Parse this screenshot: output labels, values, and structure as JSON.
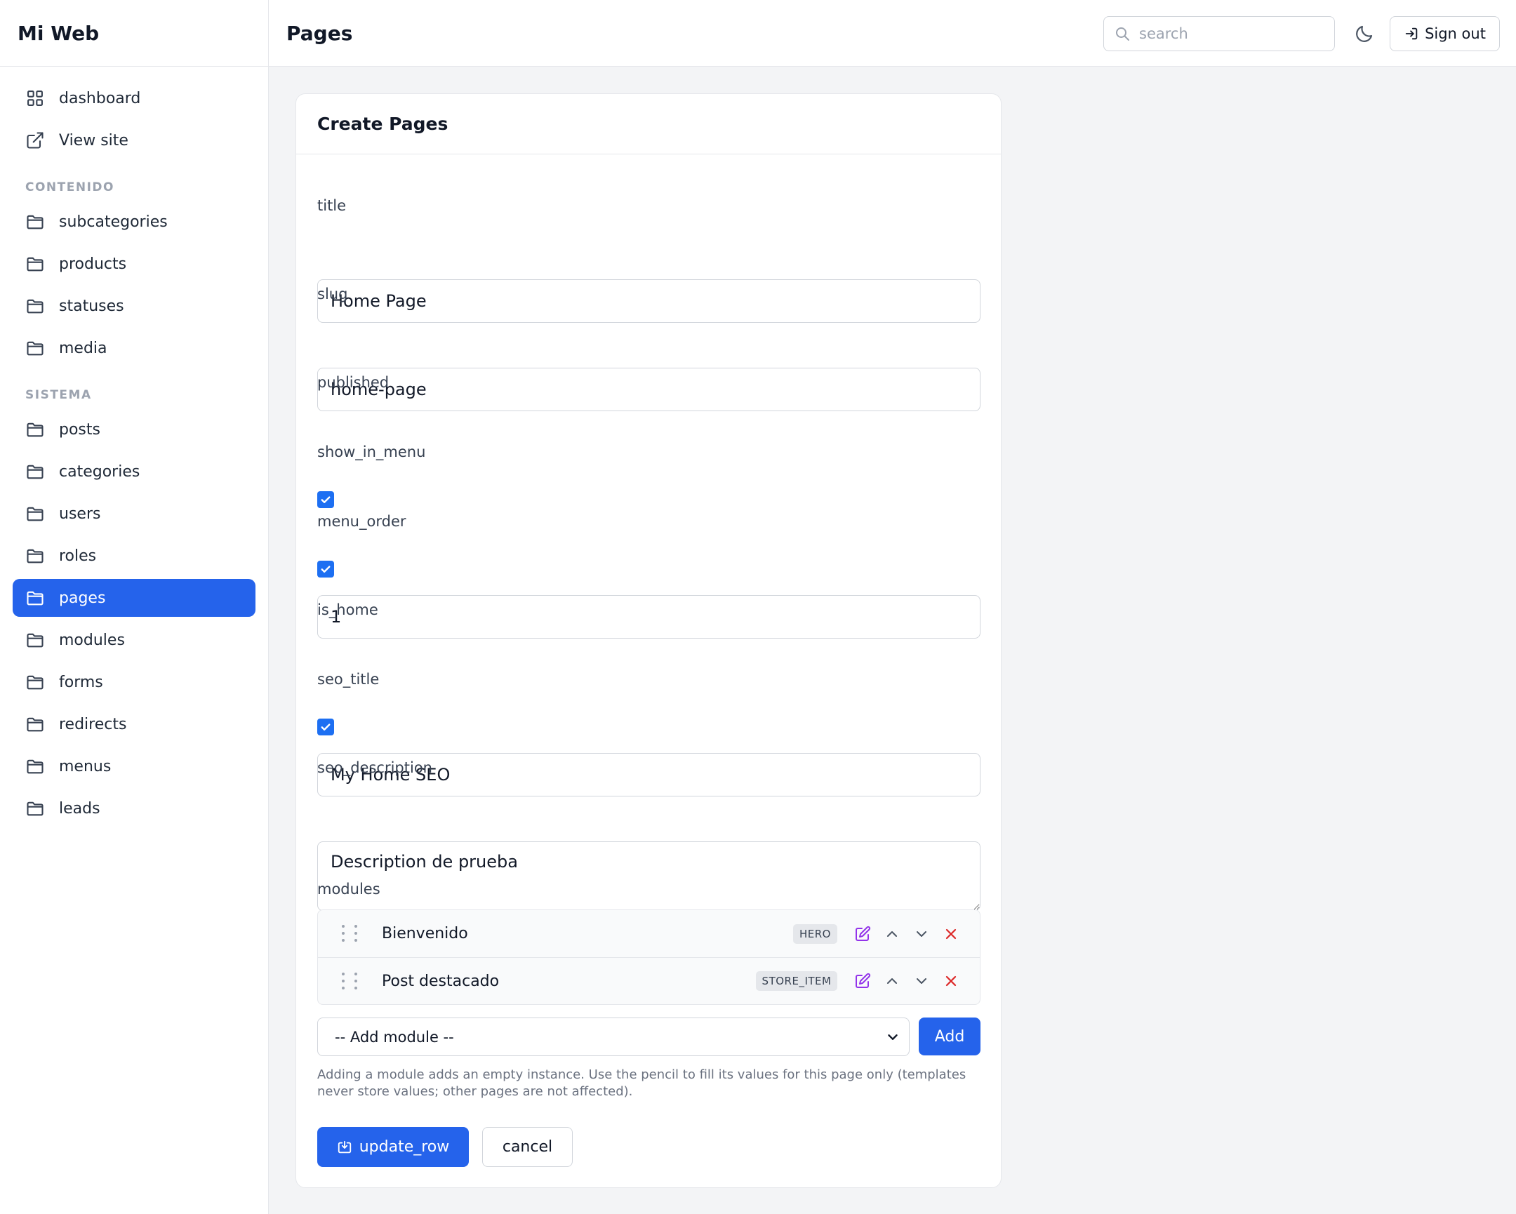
{
  "app": {
    "name": "Mi Web"
  },
  "header": {
    "title": "Pages",
    "search_placeholder": "search",
    "theme_icon": "moon-icon",
    "sign_out_label": "Sign out"
  },
  "sidebar": {
    "top_items": [
      {
        "label": "dashboard",
        "icon": "grid-icon"
      },
      {
        "label": "View site",
        "icon": "external-link-icon"
      }
    ],
    "sections": [
      {
        "title": "CONTENIDO",
        "items": [
          {
            "label": "subcategories",
            "icon": "folder-icon"
          },
          {
            "label": "products",
            "icon": "folder-icon"
          },
          {
            "label": "statuses",
            "icon": "folder-icon"
          },
          {
            "label": "media",
            "icon": "folder-icon"
          }
        ]
      },
      {
        "title": "SISTEMA",
        "items": [
          {
            "label": "posts",
            "icon": "folder-icon"
          },
          {
            "label": "categories",
            "icon": "folder-icon"
          },
          {
            "label": "users",
            "icon": "folder-icon"
          },
          {
            "label": "roles",
            "icon": "folder-icon"
          },
          {
            "label": "pages",
            "icon": "folder-icon",
            "active": true
          },
          {
            "label": "modules",
            "icon": "folder-icon"
          },
          {
            "label": "forms",
            "icon": "folder-icon"
          },
          {
            "label": "redirects",
            "icon": "folder-icon"
          },
          {
            "label": "menus",
            "icon": "folder-icon"
          },
          {
            "label": "leads",
            "icon": "folder-icon"
          }
        ]
      }
    ]
  },
  "form": {
    "card_title": "Create Pages",
    "fields": {
      "title": {
        "label": "title",
        "value": "Home Page"
      },
      "slug": {
        "label": "slug",
        "value": "home-page"
      },
      "published": {
        "label": "published",
        "checked": true
      },
      "show_in_menu": {
        "label": "show_in_menu",
        "checked": true
      },
      "menu_order": {
        "label": "menu_order",
        "value": "1"
      },
      "is_home": {
        "label": "is_home",
        "checked": true
      },
      "seo_title": {
        "label": "seo_title",
        "value": "My Home SEO"
      },
      "seo_description": {
        "label": "seo_description",
        "value": "Description de prueba"
      }
    },
    "modules": {
      "label": "modules",
      "items": [
        {
          "name": "Bienvenido",
          "type": "HERO"
        },
        {
          "name": "Post destacado",
          "type": "STORE_ITEM"
        }
      ],
      "add_select_value": "-- Add module --",
      "add_button_label": "Add",
      "help_text": "Adding a module adds an empty instance. Use the pencil to fill its values for this page only (templates never store values; other pages are not affected)."
    },
    "submit_label": "update_row",
    "cancel_label": "cancel"
  },
  "colors": {
    "accent": "#2563eb",
    "edit_icon": "#9333ea",
    "delete_icon": "#dc2626",
    "checkbox": "#1d6ff2"
  }
}
